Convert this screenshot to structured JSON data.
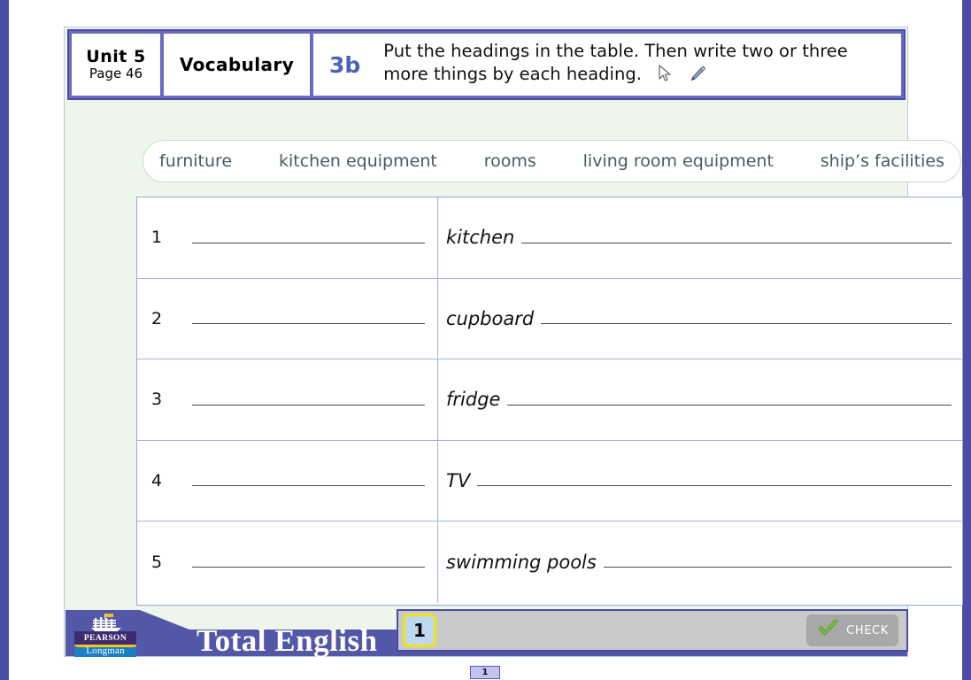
{
  "header": {
    "unit_title": "Unit 5",
    "unit_page": "Page 46",
    "topic": "Vocabulary",
    "task_number": "3b",
    "task_text": "Put the headings in the table. Then write two or three more things by each heading.",
    "cursor_icon": "arrow-cursor-icon",
    "pencil_icon": "pencil-icon"
  },
  "word_bank": {
    "words": [
      "furniture",
      "kitchen equipment",
      "rooms",
      "living room equipment",
      "ship’s facilities"
    ]
  },
  "table": {
    "rows": [
      {
        "number": "1",
        "heading_answer": "",
        "example": "kitchen"
      },
      {
        "number": "2",
        "heading_answer": "",
        "example": "cupboard"
      },
      {
        "number": "3",
        "heading_answer": "",
        "example": "fridge"
      },
      {
        "number": "4",
        "heading_answer": "",
        "example": "TV"
      },
      {
        "number": "5",
        "heading_answer": "",
        "example": "swimming pools"
      }
    ]
  },
  "footer": {
    "brand_title": "Total English",
    "publisher_primary": "PEARSON",
    "publisher_secondary": "Longman",
    "ship_icon": "ship-icon"
  },
  "navbar": {
    "page_number": "1",
    "check_label": "CHECK",
    "check_icon": "green-check-icon"
  },
  "slide_indicator": {
    "label": "1"
  },
  "colors": {
    "frame_purple": "#4b4ba8",
    "header_purple": "#6a6ac0",
    "panel_mint": "#eef6ec",
    "task_number_blue": "#4b63b4",
    "table_border": "#a7b2de",
    "footer_purple": "#5257a8",
    "check_green": "#7ac143",
    "page_btn_yellow": "#f5e214",
    "page_btn_blue": "#bcd9ef"
  }
}
